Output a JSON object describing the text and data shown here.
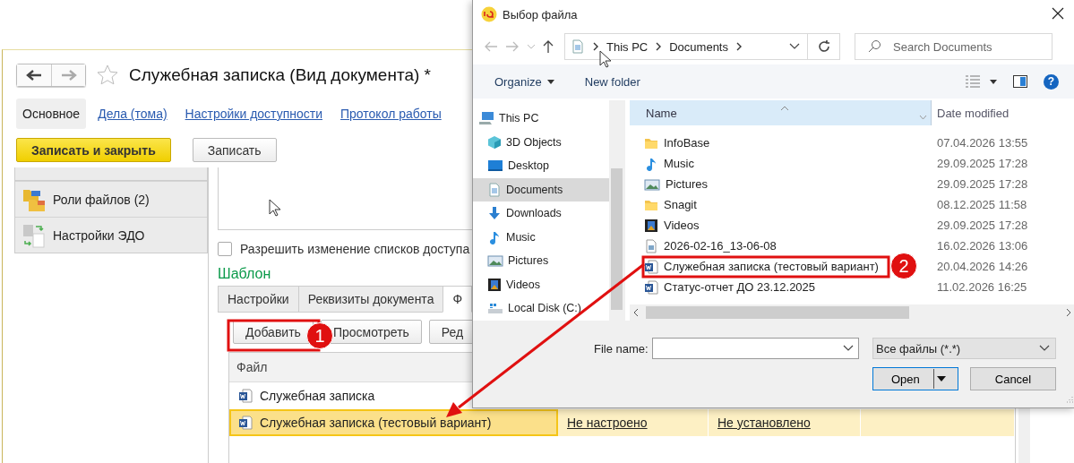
{
  "app": {
    "title": "Служебная записка (Вид документа) *",
    "tabs": [
      {
        "label": "Основное",
        "selected": true
      },
      {
        "label": "Дела (тома)",
        "selected": false
      },
      {
        "label": "Настройки доступности",
        "selected": false
      },
      {
        "label": "Протокол работы",
        "selected": false
      }
    ],
    "buttons": [
      {
        "label": "Записать и закрыть",
        "kind": "primary"
      },
      {
        "label": "Записать",
        "kind": "default"
      }
    ],
    "sidebar": [
      {
        "label": "Роли файлов (2)",
        "kind": "folders"
      },
      {
        "label": "Настройки ЭДО",
        "kind": "exchange"
      }
    ],
    "checkbox": {
      "label": "Разрешить изменение списков доступа",
      "checked": false
    },
    "section_title": "Шаблон",
    "template_tabs": [
      {
        "label": "Настройки",
        "selected": false
      },
      {
        "label": "Реквизиты документа",
        "selected": false
      },
      {
        "label": "Ф",
        "selected": true
      }
    ],
    "template_buttons": [
      "Добавить",
      "Просмотреть",
      "Ред"
    ],
    "table": {
      "columns": [
        "Файл"
      ],
      "rows": [
        {
          "cells": [
            "Служебная записка"
          ],
          "selected": false
        },
        {
          "cells": [
            "Служебная записка (тестовый вариант)",
            "Не настроено",
            "Не установлено"
          ],
          "selected": true
        }
      ]
    }
  },
  "dialog": {
    "title": "Выбор файла",
    "breadcrumb": [
      "This PC",
      "Documents"
    ],
    "search": {
      "placeholder": "Search Documents"
    },
    "toolbar": [
      "Organize",
      "New folder"
    ],
    "help": "?",
    "nav": [
      {
        "label": "This PC",
        "kind": "pc",
        "selected": false
      },
      {
        "label": "3D Objects",
        "kind": "cube",
        "selected": false
      },
      {
        "label": "Desktop",
        "kind": "desktop",
        "selected": false
      },
      {
        "label": "Documents",
        "kind": "documents",
        "selected": true
      },
      {
        "label": "Downloads",
        "kind": "downloads",
        "selected": false
      },
      {
        "label": "Music",
        "kind": "music",
        "selected": false
      },
      {
        "label": "Pictures",
        "kind": "pictures",
        "selected": false
      },
      {
        "label": "Videos",
        "kind": "videos",
        "selected": false
      },
      {
        "label": "Local Disk (C:)",
        "kind": "disk",
        "selected": false
      }
    ],
    "columns": [
      "Name",
      "Date modified"
    ],
    "files": [
      {
        "name": "InfoBase",
        "date": "07.04.2026 13:55",
        "kind": "folder"
      },
      {
        "name": "Music",
        "date": "29.09.2025 17:28",
        "kind": "music"
      },
      {
        "name": "Pictures",
        "date": "29.09.2025 17:28",
        "kind": "pictures"
      },
      {
        "name": "Snagit",
        "date": "08.12.2025 11:58",
        "kind": "folder"
      },
      {
        "name": "Videos",
        "date": "29.09.2025 17:28",
        "kind": "videos"
      },
      {
        "name": "2026-02-16_13-06-08",
        "date": "16.02.2026 13:06",
        "kind": "image"
      },
      {
        "name": "Служебная записка (тестовый вариант)",
        "date": "20.04.2026 14:26",
        "kind": "word"
      },
      {
        "name": "Статус-отчет ДО 23.12.2025",
        "date": "11.02.2026 16:25",
        "kind": "word"
      }
    ],
    "file_name_label": "File name:",
    "filter": "Все файлы (*.*)",
    "buttons": [
      "Open",
      "Cancel"
    ]
  },
  "annotations": [
    {
      "label": "1"
    },
    {
      "label": "2"
    }
  ]
}
